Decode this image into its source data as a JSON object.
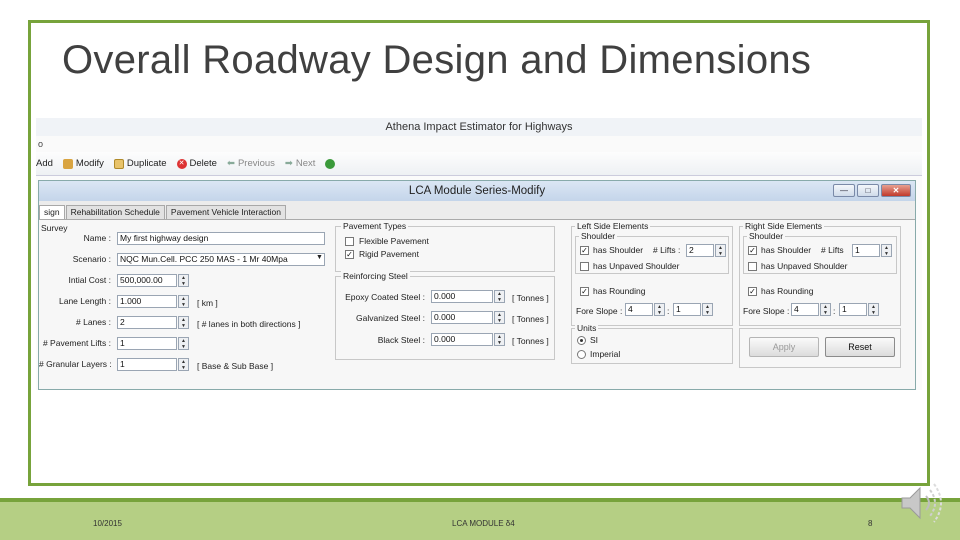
{
  "slide": {
    "title": "Overall Roadway Design and Dimensions",
    "footer_date": "10/2015",
    "footer_center": "LCA MODULE δ4",
    "page_number": "8",
    "accent_color": "#77a33b",
    "footer_color": "#b5cf84"
  },
  "app": {
    "title": "Athena Impact Estimator for Highways",
    "menu_fragment": "o",
    "toolbar": {
      "add": "Add",
      "modify": "Modify",
      "duplicate": "Duplicate",
      "delete": "Delete",
      "previous": "Previous",
      "next": "Next"
    },
    "dialog": {
      "title": "LCA Module Series-Modify",
      "min_glyph": "—",
      "max_glyph": "□",
      "close_glyph": "✕",
      "tabs": [
        "sign",
        "Rehabilitation Schedule",
        "Pavement Vehicle Interaction"
      ],
      "survey_label": "Survey",
      "fields": {
        "name_label": "Name :",
        "name_value": "My first highway design",
        "scenario_label": "Scenario :",
        "scenario_value": "NQC Mun.Cell. PCC 250 MAS - 1 Mr 40Mpa",
        "initial_cost_label": "Intial Cost :",
        "initial_cost_value": "500,000.00",
        "lane_length_label": "Lane Length :",
        "lane_length_value": "1.000",
        "lane_length_unit": "[ km ]",
        "lanes_label": "# Lanes :",
        "lanes_value": "2",
        "lanes_unit": "[ # lanes in both directions ]",
        "pavement_lifts_label": "# Pavement Lifts :",
        "pavement_lifts_value": "1",
        "granular_layers_label": "# Granular Layers :",
        "granular_layers_value": "1",
        "granular_layers_unit": "[ Base & Sub Base ]"
      },
      "pavement_types": {
        "title": "Pavement Types",
        "flexible": "Flexible Pavement",
        "flexible_checked": false,
        "rigid": "Rigid Pavement",
        "rigid_checked": true
      },
      "reinforcing_steel": {
        "title": "Reinforcing Steel",
        "epoxy_label": "Epoxy Coated Steel :",
        "epoxy_value": "0.000",
        "galvanized_label": "Galvanized Steel :",
        "galvanized_value": "0.000",
        "black_label": "Black Steel :",
        "black_value": "0.000",
        "unit": "[ Tonnes ]"
      },
      "left_side": {
        "title": "Left Side Elements",
        "shoulder_title": "Shoulder",
        "has_shoulder": "has Shoulder",
        "has_shoulder_checked": true,
        "lifts_label": "# Lifts :",
        "lifts_value": "2",
        "unpaved": "has Unpaved Shoulder",
        "unpaved_checked": false,
        "rounding": "has Rounding",
        "rounding_checked": true,
        "fore_slope_label": "Fore Slope :",
        "fore_slope_a": "4",
        "fore_slope_sep": ":",
        "fore_slope_b": "1"
      },
      "right_side": {
        "title": "Right Side Elements",
        "shoulder_title": "Shoulder",
        "has_shoulder": "has Shoulder",
        "has_shoulder_checked": true,
        "lifts_label": "# Lifts",
        "lifts_value": "1",
        "unpaved": "has Unpaved Shoulder",
        "unpaved_checked": false,
        "rounding": "has Rounding",
        "rounding_checked": true,
        "fore_slope_label": "Fore Slope :",
        "fore_slope_a": "4",
        "fore_slope_sep": ":",
        "fore_slope_b": "1"
      },
      "units": {
        "title": "Units",
        "si": "SI",
        "imperial": "Imperial",
        "selected": "SI"
      },
      "buttons": {
        "apply": "Apply",
        "reset": "Reset"
      }
    }
  }
}
